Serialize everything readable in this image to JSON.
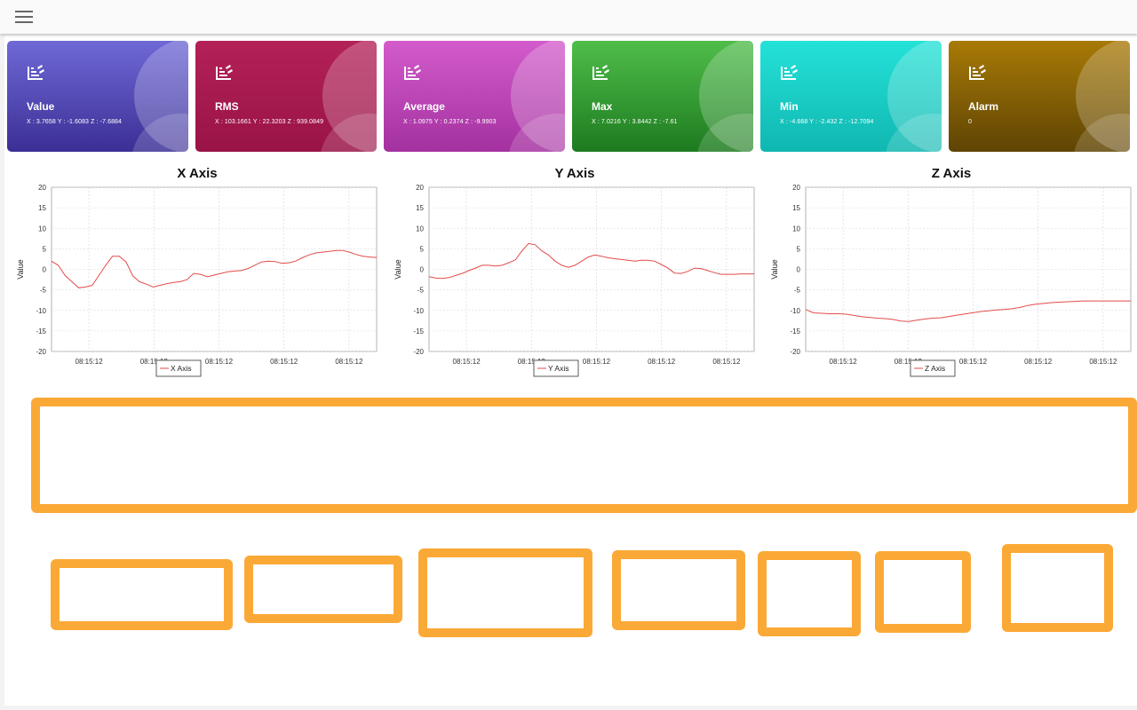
{
  "topbar": {
    "menu_icon": "hamburger-menu-icon"
  },
  "cards": [
    {
      "title": "Value",
      "values": "X : 3.7658   Y : -1.6083   Z : -7.6884",
      "gradient": [
        "#6f69d6",
        "#3b2f95"
      ]
    },
    {
      "title": "RMS",
      "values": "X : 103.1661   Y : 22.3203   Z : 939.0849",
      "gradient": [
        "#b32158",
        "#991347"
      ]
    },
    {
      "title": "Average",
      "values": "X : 1.0975   Y : 0.2374   Z : -9.9903",
      "gradient": [
        "#d35bcb",
        "#a431a0"
      ]
    },
    {
      "title": "Max",
      "values": "X : 7.0216   Y : 3.8442   Z : -7.61",
      "gradient": [
        "#4fbd4a",
        "#1d7b1f"
      ]
    },
    {
      "title": "Min",
      "values": "X : -4.668   Y : -2.432   Z : -12.7094",
      "gradient": [
        "#24e2d8",
        "#10b7b1"
      ]
    },
    {
      "title": "Alarm",
      "values": "0",
      "gradient": [
        "#a87a06",
        "#5f4404"
      ]
    }
  ],
  "chart_data": [
    {
      "type": "line",
      "title": "X Axis",
      "ylabel": "Value",
      "ylim": [
        -20,
        20
      ],
      "yticks": [
        20,
        15,
        10,
        5,
        0,
        -5,
        -10,
        -15,
        -20
      ],
      "xtick_labels": [
        "08:15:12",
        "08:15:12",
        "08:15:12",
        "08:15:12",
        "08:15:12"
      ],
      "legend": "X Axis",
      "grid": true,
      "color": "#e34b4b",
      "series": [
        {
          "name": "X Axis",
          "values": [
            2.0,
            1.0,
            -1.5,
            -3.0,
            -4.5,
            -4.3,
            -3.9,
            -1.5,
            1.0,
            3.2,
            3.2,
            1.8,
            -1.6,
            -3.0,
            -3.6,
            -4.3,
            -3.9,
            -3.5,
            -3.2,
            -3.0,
            -2.5,
            -1.0,
            -1.2,
            -1.8,
            -1.4,
            -1.0,
            -0.6,
            -0.4,
            -0.3,
            0.2,
            1.0,
            1.8,
            2.0,
            1.9,
            1.5,
            1.6,
            2.0,
            2.8,
            3.5,
            4.0,
            4.2,
            4.4,
            4.6,
            4.6,
            4.2,
            3.6,
            3.2,
            3.0,
            2.9
          ]
        }
      ]
    },
    {
      "type": "line",
      "title": "Y Axis",
      "ylabel": "Value",
      "ylim": [
        -20,
        20
      ],
      "yticks": [
        20,
        15,
        10,
        5,
        0,
        -5,
        -10,
        -15,
        -20
      ],
      "xtick_labels": [
        "08:15:12",
        "08:15:12",
        "08:15:12",
        "08:15:12",
        "08:15:12"
      ],
      "legend": "Y Axis",
      "grid": true,
      "color": "#e34b4b",
      "series": [
        {
          "name": "Y Axis",
          "values": [
            -1.8,
            -2.1,
            -2.2,
            -2.0,
            -1.5,
            -1.0,
            -0.3,
            0.3,
            1.0,
            1.0,
            0.8,
            1.0,
            1.6,
            2.3,
            4.5,
            6.3,
            6.0,
            4.5,
            3.5,
            2.0,
            1.0,
            0.5,
            1.0,
            2.0,
            3.0,
            3.5,
            3.2,
            2.8,
            2.6,
            2.4,
            2.2,
            2.0,
            2.2,
            2.2,
            2.0,
            1.2,
            0.3,
            -0.9,
            -1.0,
            -0.5,
            0.3,
            0.2,
            -0.3,
            -0.8,
            -1.2,
            -1.2,
            -1.2,
            -1.1,
            -1.1,
            -1.1
          ]
        }
      ]
    },
    {
      "type": "line",
      "title": "Z Axis",
      "ylabel": "Value",
      "ylim": [
        -20,
        20
      ],
      "yticks": [
        20,
        15,
        10,
        5,
        0,
        -5,
        -10,
        -15,
        -20
      ],
      "xtick_labels": [
        "08:15:12",
        "08:15:12",
        "08:15:12",
        "08:15:12",
        "08:15:12"
      ],
      "legend": "Z Axis",
      "grid": true,
      "color": "#e34b4b",
      "series": [
        {
          "name": "Z Axis",
          "values": [
            -9.8,
            -10.6,
            -10.7,
            -10.8,
            -10.8,
            -10.9,
            -11.2,
            -11.5,
            -11.7,
            -11.9,
            -12.0,
            -12.2,
            -12.6,
            -12.7,
            -12.4,
            -12.1,
            -11.9,
            -11.8,
            -11.5,
            -11.2,
            -10.9,
            -10.6,
            -10.3,
            -10.1,
            -9.9,
            -9.8,
            -9.6,
            -9.3,
            -8.8,
            -8.5,
            -8.3,
            -8.1,
            -8.0,
            -7.9,
            -7.8,
            -7.7,
            -7.7,
            -7.7,
            -7.7,
            -7.7,
            -7.7,
            -7.7
          ]
        }
      ]
    }
  ]
}
